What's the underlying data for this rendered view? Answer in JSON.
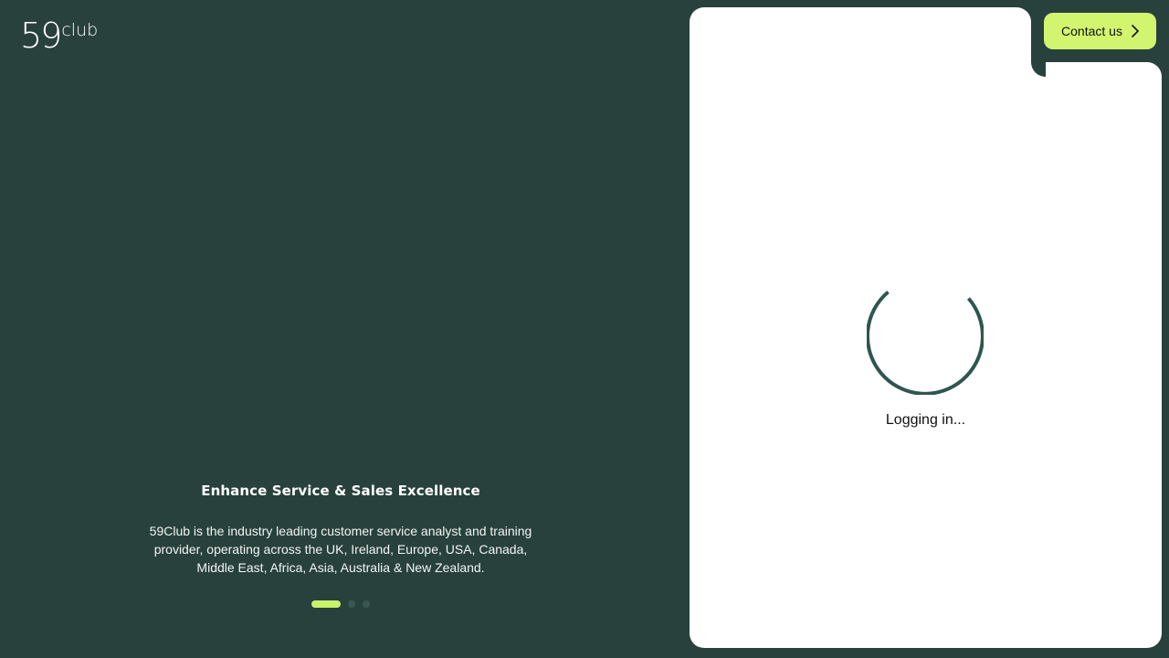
{
  "logo": {
    "number": "59",
    "text": "club"
  },
  "carousel": {
    "title": "Enhance Service & Sales Excellence",
    "description": "59Club is the industry leading customer service analyst and training provider, operating across the UK, Ireland, Europe, USA, Canada, Middle East, Africa, Asia, Australia & New Zealand.",
    "slide_count": 3,
    "active_index": 0
  },
  "header": {
    "contact_label": "Contact us",
    "contact_icon": "chevron-right-icon"
  },
  "status": {
    "loading_text": "Logging in..."
  },
  "colors": {
    "background": "#28413d",
    "accent": "#d2f56f",
    "panel": "#ffffff",
    "spinner": "#2f554f"
  }
}
